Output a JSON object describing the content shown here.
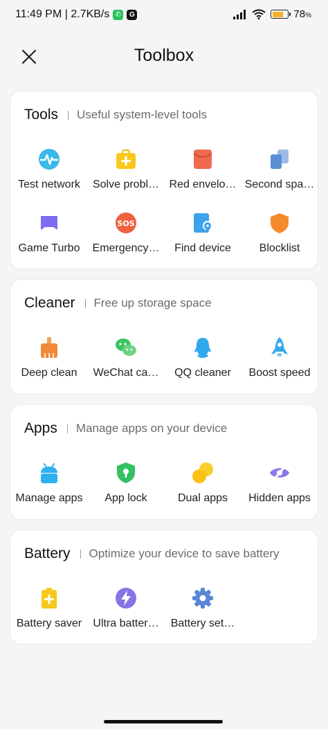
{
  "status_bar": {
    "time_speed": "11:49 PM | 2.7KB/s",
    "battery_level": "78",
    "battery_unit": "%",
    "battery_fraction": 0.78,
    "battery_color": "#f0b323"
  },
  "header": {
    "title": "Toolbox",
    "close_icon": "close-icon"
  },
  "sections": {
    "tools": {
      "title": "Tools",
      "subtitle": "Useful system-level tools",
      "items": [
        {
          "label": "Test network",
          "icon": "test-network-icon"
        },
        {
          "label": "Solve probl…",
          "icon": "solve-problems-icon"
        },
        {
          "label": "Red envelo…",
          "icon": "red-envelope-icon"
        },
        {
          "label": "Second spa…",
          "icon": "second-space-icon"
        },
        {
          "label": "Game Turbo",
          "icon": "game-turbo-icon"
        },
        {
          "label": "Emergency…",
          "icon": "sos-icon"
        },
        {
          "label": "Find device",
          "icon": "find-device-icon"
        },
        {
          "label": "Blocklist",
          "icon": "blocklist-icon"
        }
      ]
    },
    "cleaner": {
      "title": "Cleaner",
      "subtitle": "Free up storage space",
      "items": [
        {
          "label": "Deep clean",
          "icon": "broom-icon"
        },
        {
          "label": "WeChat ca…",
          "icon": "wechat-icon"
        },
        {
          "label": "QQ cleaner",
          "icon": "qq-icon"
        },
        {
          "label": "Boost speed",
          "icon": "rocket-icon"
        }
      ]
    },
    "apps": {
      "title": "Apps",
      "subtitle": "Manage apps on your device",
      "items": [
        {
          "label": "Manage apps",
          "icon": "android-icon"
        },
        {
          "label": "App lock",
          "icon": "lock-shield-icon"
        },
        {
          "label": "Dual apps",
          "icon": "dual-apps-icon"
        },
        {
          "label": "Hidden apps",
          "icon": "hidden-eye-icon"
        }
      ]
    },
    "battery": {
      "title": "Battery",
      "subtitle": "Optimize your device to save battery",
      "items": [
        {
          "label": "Battery saver",
          "icon": "battery-saver-icon"
        },
        {
          "label": "Ultra batter…",
          "icon": "ultra-battery-icon"
        },
        {
          "label": "Battery set…",
          "icon": "gear-icon"
        }
      ]
    }
  }
}
